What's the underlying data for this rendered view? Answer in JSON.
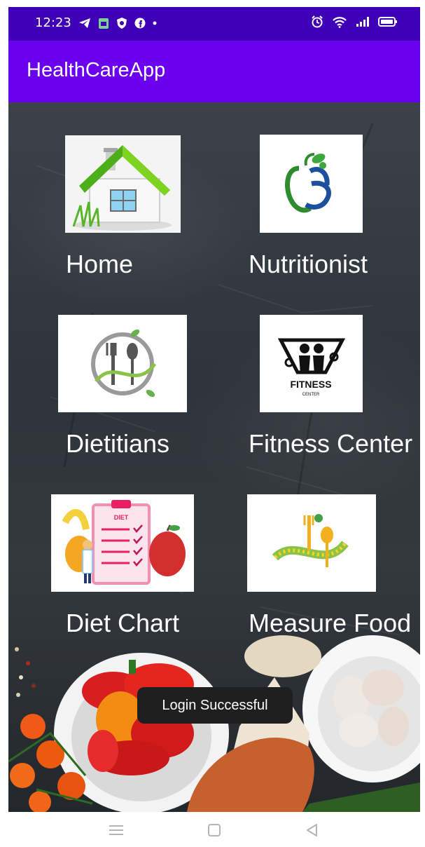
{
  "status": {
    "time": "12:23",
    "left_icons": [
      "telegram-icon",
      "calendar-icon",
      "vpn-shield-icon",
      "facebook-icon",
      "more-dot-icon"
    ],
    "right_icons": [
      "alarm-icon",
      "wifi-icon",
      "signal-icon",
      "battery-icon"
    ]
  },
  "app": {
    "title": "HealthCareApp"
  },
  "grid": {
    "items": [
      {
        "label": "Home",
        "icon": "house-icon"
      },
      {
        "label": "Nutritionist",
        "icon": "nutritionist-logo-icon"
      },
      {
        "label": "Dietitians",
        "icon": "fork-spoon-plate-icon"
      },
      {
        "label": "Fitness Center",
        "icon": "fitness-center-logo-icon"
      },
      {
        "label": "Diet Chart",
        "icon": "diet-chart-icon"
      },
      {
        "label": "Measure Food",
        "icon": "measure-tape-spoon-icon"
      }
    ]
  },
  "toast": {
    "message": "Login Successful"
  },
  "nav": {
    "buttons": [
      "menu-icon",
      "home-square-icon",
      "back-triangle-icon"
    ]
  },
  "colors": {
    "status_bar": "#3f00b8",
    "app_bar": "#6a00ee",
    "toast_bg": "#1f1f1f"
  }
}
